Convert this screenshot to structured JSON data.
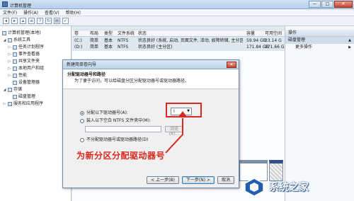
{
  "window": {
    "title": "计算机管理",
    "controls": [
      "—",
      "□",
      "✕"
    ]
  },
  "menu": [
    "文件(F)",
    "操作(A)",
    "查看(V)",
    "帮助(H)"
  ],
  "tree": [
    {
      "label": "计算机管理(本地)",
      "indent": 0,
      "toggle": ""
    },
    {
      "label": "系统工具",
      "indent": 1,
      "toggle": "◢"
    },
    {
      "label": "任务计划程序",
      "indent": 2,
      "toggle": "▷"
    },
    {
      "label": "事件查看器",
      "indent": 2,
      "toggle": "▷"
    },
    {
      "label": "共享文件夹",
      "indent": 2,
      "toggle": "▷"
    },
    {
      "label": "本地用户和组",
      "indent": 2,
      "toggle": "▷"
    },
    {
      "label": "性能",
      "indent": 2,
      "toggle": "▷"
    },
    {
      "label": "设备管理器",
      "indent": 2,
      "toggle": ""
    },
    {
      "label": "存储",
      "indent": 1,
      "toggle": "◢"
    },
    {
      "label": "磁盘管理",
      "indent": 2,
      "toggle": ""
    },
    {
      "label": "服务和应用程序",
      "indent": 1,
      "toggle": "▷"
    }
  ],
  "columns": {
    "vol": "卷",
    "layout": "布局",
    "type": "类型",
    "fs": "文件系统",
    "status": "状态",
    "capacity": "容量",
    "free": "可用空间"
  },
  "volumes": [
    {
      "vol": "(C:)",
      "layout": "简单",
      "type": "基本",
      "fs": "NTFS",
      "status": "状态良好 (系统, 启动, 页面文件, 活动, 故障转储, 主分区)",
      "capacity": "59.94 GB",
      "free": "33.14 G"
    },
    {
      "vol": "(D:)",
      "layout": "简单",
      "type": "基本",
      "fs": "NTFS",
      "status": "状态良好 (主分区)",
      "capacity": "171.84 GB",
      "free": "171.66 G"
    }
  ],
  "actions": {
    "header": "操作",
    "selected": "磁盘管理",
    "more": "更多操作"
  },
  "dialog": {
    "title": "新建简单卷向导",
    "heading": "分配驱动器号和路径",
    "description": "为了便于访问，可以给磁盘分区分配驱动器号或驱动器路径。",
    "option_assign": "分配以下驱动器号(A):",
    "drive_letter": "I",
    "option_mount": "装入以下空白 NTFS 文件夹中(M):",
    "browse": "浏览(R)...",
    "option_none": "不分配驱动器号或驱动器路径(D)",
    "back": "< 上一步(B)",
    "next": "下一步(N) >",
    "cancel": "取消"
  },
  "annotation": "为新分区分配驱动器号",
  "watermark": "系统之家",
  "colors": {
    "highlight": "#d9281e",
    "titlebar": "#bcd3ea"
  }
}
